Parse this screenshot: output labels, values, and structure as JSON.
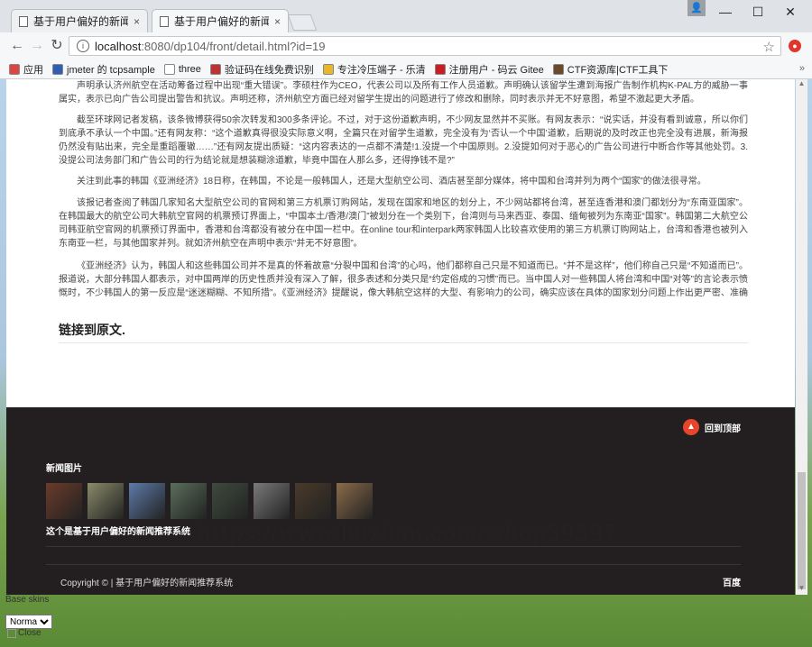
{
  "browser": {
    "tabs": [
      {
        "title": "基于用户偏好的新闻推荐"
      },
      {
        "title": "基于用户偏好的新闻推荐"
      }
    ],
    "url_host": "localhost",
    "url_rest": ":8080/dp104/front/detail.html?id=19",
    "bookmarks": [
      {
        "label": "应用",
        "icon": "apps-icon",
        "color": "#d44"
      },
      {
        "label": "jmeter 的 tcpsample",
        "icon": "shield-icon",
        "color": "#2f5fb3"
      },
      {
        "label": "three",
        "icon": "document-icon",
        "color": "#fff"
      },
      {
        "label": "验证码在线免费识别",
        "icon": "bug-icon",
        "color": "#b33"
      },
      {
        "label": "专注冷压端子 - 乐清",
        "icon": "folder-icon",
        "color": "#e8b52b"
      },
      {
        "label": "注册用户 - 码云 Gitee",
        "icon": "gitee-icon",
        "color": "#c71d23"
      },
      {
        "label": "CTF资源库|CTF工具下",
        "icon": "user-icon",
        "color": "#6a4a2a"
      }
    ]
  },
  "article": {
    "paragraphs": [
      "声明承认济州航空在活动筹备过程中出现“重大错误”。李硕柱作为CEO，代表公司以及所有工作人员道歉。声明确认该留学生遭到海报广告制作机构K-PAL方的威胁一事属实，表示已向广告公司提出警告和抗议。声明还称，济州航空方面已经对留学生提出的问题进行了修改和删除，同时表示并无不好意图，希望不激起更大矛盾。",
      "截至环球网记者发稿，该条微博获得50余次转发和300多条评论。不过，对于这份道歉声明，不少网友显然并不买账。有网友表示：“说实话，并没有看到诚意，所以你们到底承不承认一个中国。”还有网友称：“这个道歉真得很没实际意义啊，全篇只在对留学生道歉，完全没有为‘否认一个中国’道歉，后期说的及时改正也完全没有进展，新海报仍然没有贴出来，完全是重蹈覆辙……”还有网友提出质疑：“这内容表达的一点都不清楚!1.没提一个中国原则。2.没提如何对于恶心的广告公司进行中断合作等其他处罚。3.没提公司法务部门和广告公司的行为结论就是想装糊涂道歉，毕竟中国在人那么多，还得挣钱不是?”",
      "关注到此事的韩国《亚洲经济》18日称，在韩国，不论是一般韩国人，还是大型航空公司、酒店甚至部分媒体，将中国和台湾并列为两个“国家”的做法很寻常。",
      "该报记者查阅了韩国几家知名大型航空公司的官网和第三方机票订购网站，发现在国家和地区的划分上，不少网站都将台湾，甚至连香港和澳门都划分为“东南亚国家”。在韩国最大的航空公司大韩航空官网的机票预订界面上，“中国本土/香港/澳门”被划分在一个类别下，台湾则与马来西亚、泰国、缅甸被列为东南亚“国家”。韩国第二大航空公司韩亚航空官网的机票预订界面中，香港和台湾都没有被分在中国一栏中。在online tour和interpark两家韩国人比较喜欢使用的第三方机票订购网站上，台湾和香港也被列入东南亚一栏，与其他国家并列。就如济州航空在声明中表示“并无不好意图”。",
      "《亚洲经济》认为，韩国人和这些韩国公司并不是真的怀着故意“分裂中国和台湾”的心吗，他们都称自己只是不知道而已。“并不是这样”，他们称自己只是“不知道而已”。报道说，大部分韩国人都表示，对中国两岸的历史性质并没有深入了解，很多表述和分类只是“约定俗成的习惯”而已。当中国人对一些韩国人将台湾和中国“对等”的言论表示愤慨时，不少韩国人的第一反应是“迷迷糊糊、不知所措”。《亚洲经济》提醒说，像大韩航空这样的大型、有影响力的公司，确实应该在具体的国家划分问题上作出更严密、准确的分类。"
    ],
    "original_link": "链接到原文."
  },
  "footer": {
    "back_to_top": "回到顶部",
    "news_images_title": "新闻图片",
    "thumbnails": [
      {
        "color": "#6b3b2a"
      },
      {
        "color": "#8a8a6a"
      },
      {
        "color": "#5d7aa8"
      },
      {
        "color": "#5a6e5a"
      },
      {
        "color": "#3e4b3e"
      },
      {
        "color": "#7a7a7a"
      },
      {
        "color": "#4a3a2a"
      },
      {
        "color": "#8a6b4a"
      }
    ],
    "caption": "这个是基于用户偏好的新闻推荐系统",
    "copyright": "Copyright © | 基于用户偏好的新闻推荐系统",
    "baidu_link": "百度"
  },
  "watermark": "https://www.huzhan.com/ishop39397",
  "skins": {
    "label": "Base skins",
    "selected": "Normal",
    "close_alt": "Close"
  }
}
